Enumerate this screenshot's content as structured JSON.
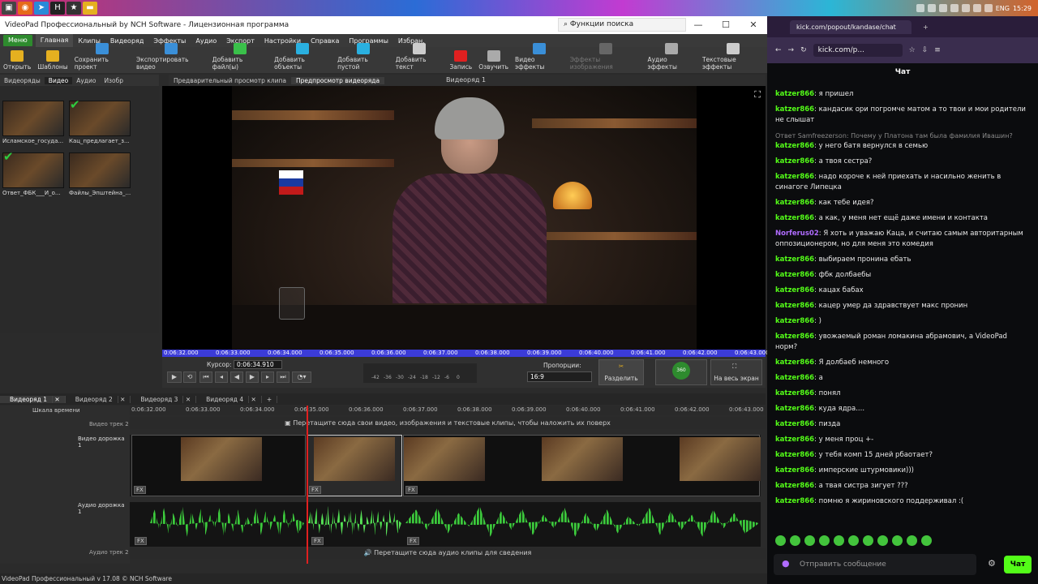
{
  "taskbar": {
    "lang": "ENG",
    "time": "15:29"
  },
  "app": {
    "title": "VideoPad Профессиональный by NCH Software - Лицензионная программа",
    "search_placeholder": "Функции поиска",
    "menu_button": "Меню",
    "menu": [
      "Главная",
      "Клипы",
      "Видеоряд",
      "Эффекты",
      "Аудио",
      "Экспорт",
      "Настройки",
      "Справка",
      "Программы",
      "Избран."
    ],
    "tools": [
      {
        "label": "Открыть",
        "color": "#e5b020"
      },
      {
        "label": "Шаблоны",
        "color": "#e5b020"
      },
      {
        "label": "Сохранить проект",
        "color": "#3a8fd8"
      },
      {
        "label": "Экспортировать видео",
        "color": "#3a8fd8"
      },
      {
        "label": "Добавить файл(ы)",
        "color": "#3ac04a"
      },
      {
        "label": "Добавить объекты",
        "color": "#2ab0e0"
      },
      {
        "label": "Добавить пустой",
        "color": "#2ab0e0"
      },
      {
        "label": "Добавить текст",
        "color": "#cccccc"
      },
      {
        "label": "Запись",
        "color": "#e02020"
      },
      {
        "label": "Озвучить",
        "color": "#aaaaaa"
      },
      {
        "label": "Видео эффекты",
        "color": "#3a8fd8"
      },
      {
        "label": "Эффекты изображения",
        "color": "#666666"
      },
      {
        "label": "Аудио эффекты",
        "color": "#aaaaaa"
      },
      {
        "label": "Текстовые эффекты",
        "color": "#cccccc"
      }
    ],
    "bin_tabs": [
      "Видеоряды",
      "Видео",
      "Аудио",
      "Изобр"
    ],
    "bin_clips": [
      "Исламское_госуда...",
      "Кац_предлагает_з...",
      "Ответ_ФБК___И_о...",
      "Файлы_Эпштейна_..."
    ],
    "preview_tabs": [
      "Предварительный просмотр клипа",
      "Предпросмотр видеоряда"
    ],
    "preview_title": "Видеоряд 1",
    "ruler_ticks": [
      "0:06:32.000",
      "0:06:33.000",
      "0:06:34.000",
      "0:06:35.000",
      "0:06:36.000",
      "0:06:37.000",
      "0:06:38.000",
      "0:06:39.000",
      "0:06:40.000",
      "0:06:41.000",
      "0:06:42.000",
      "0:06:43.000"
    ],
    "cursor_label": "Курсор:",
    "cursor_value": "0:06:34.910",
    "meter_ticks": [
      "-42",
      "-36",
      "-30",
      "-24",
      "-18",
      "-12",
      "-6",
      "0"
    ],
    "proportions_label": "Пропорции:",
    "proportions_value": "16:9",
    "split_label": "Разделить",
    "b360_label": "360",
    "fullscreen_label": "На весь экран",
    "sequence_tabs": [
      "Видеоряд 1",
      "Видеоряд 2",
      "Видеоряд 3",
      "Видеоряд 4"
    ],
    "timeline_scale": "Шкала времени",
    "timeline_ticks": [
      "0:06:32.000",
      "0:06:33.000",
      "0:06:34.000",
      "0:06:35.000",
      "0:06:36.000",
      "0:06:37.000",
      "0:06:38.000",
      "0:06:39.000",
      "0:06:40.000",
      "0:06:41.000",
      "0:06:42.000",
      "0:06:43.000"
    ],
    "video_track2": "Видео трек 2",
    "video_track2_hint": "Перетащите сюда свои видео, изображения и текстовые клипы, чтобы наложить их поверх",
    "video_track1": "Видео дорожка 1",
    "audio_track1": "Аудио дорожка 1",
    "audio_track2": "Аудио трек 2",
    "audio_track2_hint": "Перетащите сюда аудио клипы для сведения",
    "fx": "FX",
    "status": "VideoPad Профессиональный v 17.08 © NCH Software"
  },
  "browser": {
    "tab_title": "kick.com/popout/kandase/chat",
    "url": "kick.com/p...",
    "chat_title": "Чат",
    "messages": [
      {
        "user": "katzer866",
        "text": "я пришел"
      },
      {
        "user": "katzer866",
        "text": "кандасик ори погромче матом а то твои и мои родители не слышат"
      },
      {
        "reply": "Ответ Samfreezerson: Почему у Платона там была фамилия Ивашин?",
        "user": "katzer866",
        "text": "у него батя вернулся в семью"
      },
      {
        "user": "katzer866",
        "text": "а твоя сестра?"
      },
      {
        "user": "katzer866",
        "text": "надо короче к ней приехать и насильно женить в синагоге Липецка"
      },
      {
        "user": "katzer866",
        "text": "как тебе идея?"
      },
      {
        "user": "katzer866",
        "text": "а как, у меня нет ещё даже имени и контакта"
      },
      {
        "user": "Norferus02",
        "text": "Я хоть и уважаю Каца, и считаю самым авторитарным оппозиционером, но для меня это комедия",
        "purple": true
      },
      {
        "user": "katzer866",
        "text": "выбираем пронина ебать"
      },
      {
        "user": "katzer866",
        "text": "фбк долбаебы"
      },
      {
        "user": "katzer866",
        "text": "кацах бабах"
      },
      {
        "user": "katzer866",
        "text": "кацер умер да здравствует макс пронин"
      },
      {
        "user": "katzer866",
        "text": ")"
      },
      {
        "user": "katzer866",
        "text": "увожаемый роман ломакина абрамович, а VideoPad норм?"
      },
      {
        "user": "katzer866",
        "text": "Я долбаеб немного"
      },
      {
        "user": "katzer866",
        "text": "а"
      },
      {
        "user": "katzer866",
        "text": "понял"
      },
      {
        "user": "katzer866",
        "text": "куда ядра...."
      },
      {
        "user": "katzer866",
        "text": "пизда"
      },
      {
        "user": "katzer866",
        "text": "у меня проц +-"
      },
      {
        "user": "katzer866",
        "text": "у тебя комп 15 дней рбаотает?"
      },
      {
        "user": "katzer866",
        "text": "имперские штурмовики)))"
      },
      {
        "user": "katzer866",
        "text": "а твая систра зигует ???"
      },
      {
        "user": "katzer866",
        "text": "помню я жириновского поддерживал :("
      }
    ],
    "input_placeholder": "Отправить сообщение",
    "send_label": "Чат"
  }
}
